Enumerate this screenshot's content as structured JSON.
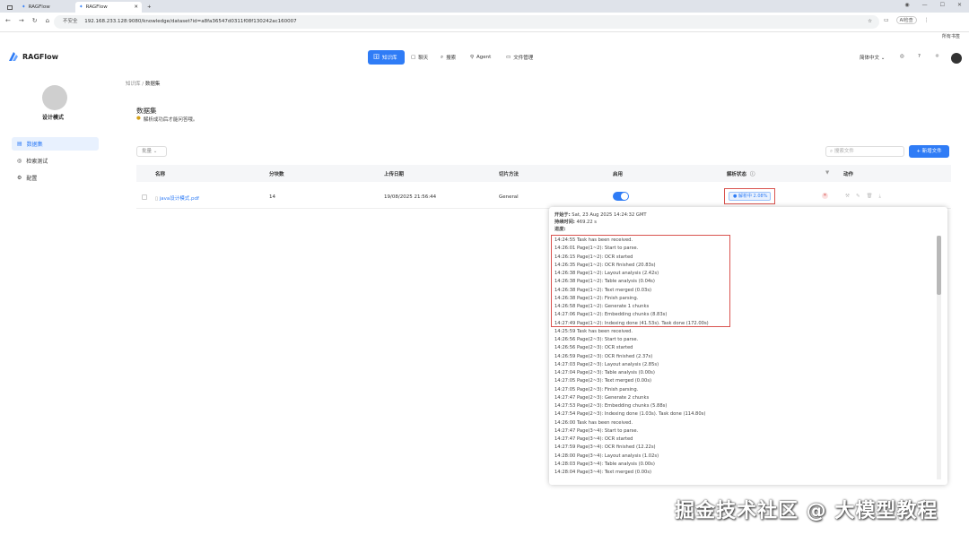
{
  "browser": {
    "tabs": [
      {
        "title": "RAGFlow"
      },
      {
        "title": "RAGFlow"
      }
    ],
    "url": "192.168.233.128:9080/knowledge/dataset?id=a8fa36547d0311f08f130242ac160007",
    "security_label": "不安全",
    "right_label": "AI检查",
    "bookmarks_label": "所有书签"
  },
  "app": {
    "logo_text": "RAGFlow",
    "nav": [
      {
        "label": "知识库",
        "icon": "database-icon",
        "active": true
      },
      {
        "label": "聊天",
        "icon": "chat-icon",
        "active": false
      },
      {
        "label": "搜索",
        "icon": "search-icon",
        "active": false
      },
      {
        "label": "Agent",
        "icon": "agent-icon",
        "active": false
      },
      {
        "label": "文件管理",
        "icon": "folder-icon",
        "active": false
      }
    ],
    "language": "简体中文"
  },
  "sidebar": {
    "kb_name": "设计模式",
    "items": [
      {
        "label": "数据集",
        "icon": "dataset-icon",
        "active": true
      },
      {
        "label": "检索测试",
        "icon": "retrieval-icon",
        "active": false
      },
      {
        "label": "配置",
        "icon": "settings-icon",
        "active": false
      }
    ]
  },
  "breadcrumb": {
    "parent": "知识库",
    "current": "数据集"
  },
  "page": {
    "title": "数据集",
    "description": "解析成功后才能问答哦。",
    "bulk_button": "批量",
    "search_placeholder": "搜索文件",
    "add_button": "新增文件"
  },
  "table": {
    "columns": [
      "名称",
      "分块数",
      "上传日期",
      "切片方法",
      "启用",
      "解析状态",
      "",
      "动作"
    ],
    "rows": [
      {
        "name": "java设计模式.pdf",
        "chunks": "14",
        "upload_date": "19/08/2025 21:56:44",
        "method": "General",
        "enabled": true,
        "status": "解析中 2.08%"
      }
    ]
  },
  "popover": {
    "start_label": "开始于:",
    "start_value": "Sat, 23 Aug 2025 14:24:32 GMT",
    "duration_label": "持续时间:",
    "duration_value": "469.22 s",
    "progress_label": "进度:",
    "log": [
      "14:24:55 Task has been received.",
      "14:26:01 Page(1~2): Start to parse.",
      "14:26:15 Page(1~2): OCR started",
      "14:26:35 Page(1~2): OCR finished (20.83s)",
      "14:26:38 Page(1~2): Layout analysis (2.42s)",
      "14:26:38 Page(1~2): Table analysis (0.04s)",
      "14:26:38 Page(1~2): Text merged (0.03s)",
      "14:26:38 Page(1~2): Finish parsing.",
      "14:26:58 Page(1~2): Generate 1 chunks",
      "14:27:06 Page(1~2): Embedding chunks (8.83s)",
      "14:27:49 Page(1~2): Indexing done (41.53s). Task done (172.00s)",
      "14:25:59 Task has been received.",
      "14:26:56 Page(2~3): Start to parse.",
      "14:26:56 Page(2~3): OCR started",
      "14:26:59 Page(2~3): OCR finished (2.37s)",
      "14:27:03 Page(2~3): Layout analysis (2.85s)",
      "14:27:04 Page(2~3): Table analysis (0.00s)",
      "14:27:05 Page(2~3): Text merged (0.00s)",
      "14:27:05 Page(2~3): Finish parsing.",
      "14:27:47 Page(2~3): Generate 2 chunks",
      "14:27:53 Page(2~3): Embedding chunks (5.88s)",
      "14:27:54 Page(2~3): Indexing done (1.03s). Task done (114.80s)",
      "14:26:00 Task has been received.",
      "14:27:47 Page(3~4): Start to parse.",
      "14:27:47 Page(3~4): OCR started",
      "14:27:59 Page(3~4): OCR finished (12.22s)",
      "14:28:00 Page(3~4): Layout analysis (1.02s)",
      "14:28:03 Page(3~4): Table analysis (0.00s)",
      "14:28:04 Page(3~4): Text merged (0.00s)"
    ]
  },
  "watermark": "掘金技术社区 @ 大模型教程",
  "colors": {
    "accent": "#2f7cf6",
    "highlight": "#d9534f"
  }
}
